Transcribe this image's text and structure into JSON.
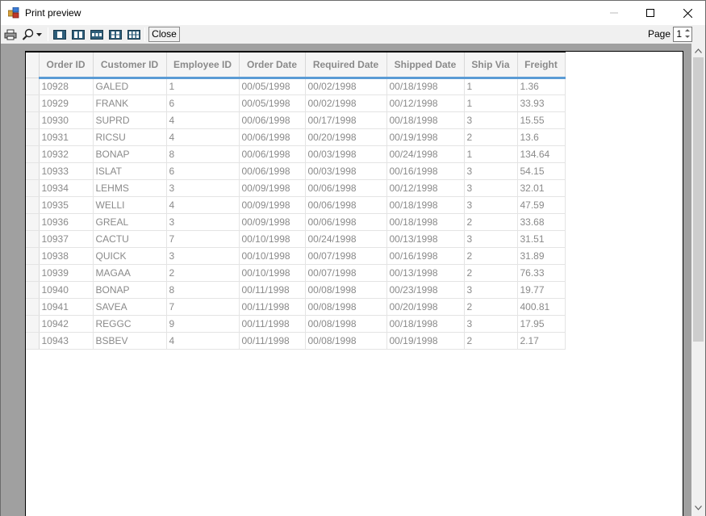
{
  "window": {
    "title": "Print preview"
  },
  "toolbar": {
    "close_label": "Close",
    "page_label": "Page",
    "page_value": "1",
    "icons": [
      "print-icon",
      "zoom-icon",
      "zoom-dropdown-icon",
      "one-page-icon",
      "two-pages-icon",
      "three-pages-icon",
      "four-pages-icon",
      "six-pages-icon"
    ]
  },
  "grid": {
    "columns": [
      "Order ID",
      "Customer ID",
      "Employee ID",
      "Order Date",
      "Required Date",
      "Shipped Date",
      "Ship Via",
      "Freight"
    ],
    "rows": [
      [
        "10928",
        "GALED",
        "1",
        "00/05/1998",
        "00/02/1998",
        "00/18/1998",
        "1",
        "1.36"
      ],
      [
        "10929",
        "FRANK",
        "6",
        "00/05/1998",
        "00/02/1998",
        "00/12/1998",
        "1",
        "33.93"
      ],
      [
        "10930",
        "SUPRD",
        "4",
        "00/06/1998",
        "00/17/1998",
        "00/18/1998",
        "3",
        "15.55"
      ],
      [
        "10931",
        "RICSU",
        "4",
        "00/06/1998",
        "00/20/1998",
        "00/19/1998",
        "2",
        "13.6"
      ],
      [
        "10932",
        "BONAP",
        "8",
        "00/06/1998",
        "00/03/1998",
        "00/24/1998",
        "1",
        "134.64"
      ],
      [
        "10933",
        "ISLAT",
        "6",
        "00/06/1998",
        "00/03/1998",
        "00/16/1998",
        "3",
        "54.15"
      ],
      [
        "10934",
        "LEHMS",
        "3",
        "00/09/1998",
        "00/06/1998",
        "00/12/1998",
        "3",
        "32.01"
      ],
      [
        "10935",
        "WELLI",
        "4",
        "00/09/1998",
        "00/06/1998",
        "00/18/1998",
        "3",
        "47.59"
      ],
      [
        "10936",
        "GREAL",
        "3",
        "00/09/1998",
        "00/06/1998",
        "00/18/1998",
        "2",
        "33.68"
      ],
      [
        "10937",
        "CACTU",
        "7",
        "00/10/1998",
        "00/24/1998",
        "00/13/1998",
        "3",
        "31.51"
      ],
      [
        "10938",
        "QUICK",
        "3",
        "00/10/1998",
        "00/07/1998",
        "00/16/1998",
        "2",
        "31.89"
      ],
      [
        "10939",
        "MAGAA",
        "2",
        "00/10/1998",
        "00/07/1998",
        "00/13/1998",
        "2",
        "76.33"
      ],
      [
        "10940",
        "BONAP",
        "8",
        "00/11/1998",
        "00/08/1998",
        "00/23/1998",
        "3",
        "19.77"
      ],
      [
        "10941",
        "SAVEA",
        "7",
        "00/11/1998",
        "00/08/1998",
        "00/20/1998",
        "2",
        "400.81"
      ],
      [
        "10942",
        "REGGC",
        "9",
        "00/11/1998",
        "00/08/1998",
        "00/18/1998",
        "3",
        "17.95"
      ],
      [
        "10943",
        "BSBEV",
        "4",
        "00/11/1998",
        "00/08/1998",
        "00/19/1998",
        "2",
        "2.17"
      ]
    ]
  },
  "colors": {
    "header_underline": "#5b9bd5",
    "preview_background": "#a0a0a0",
    "cell_text": "#8a8a8a"
  }
}
